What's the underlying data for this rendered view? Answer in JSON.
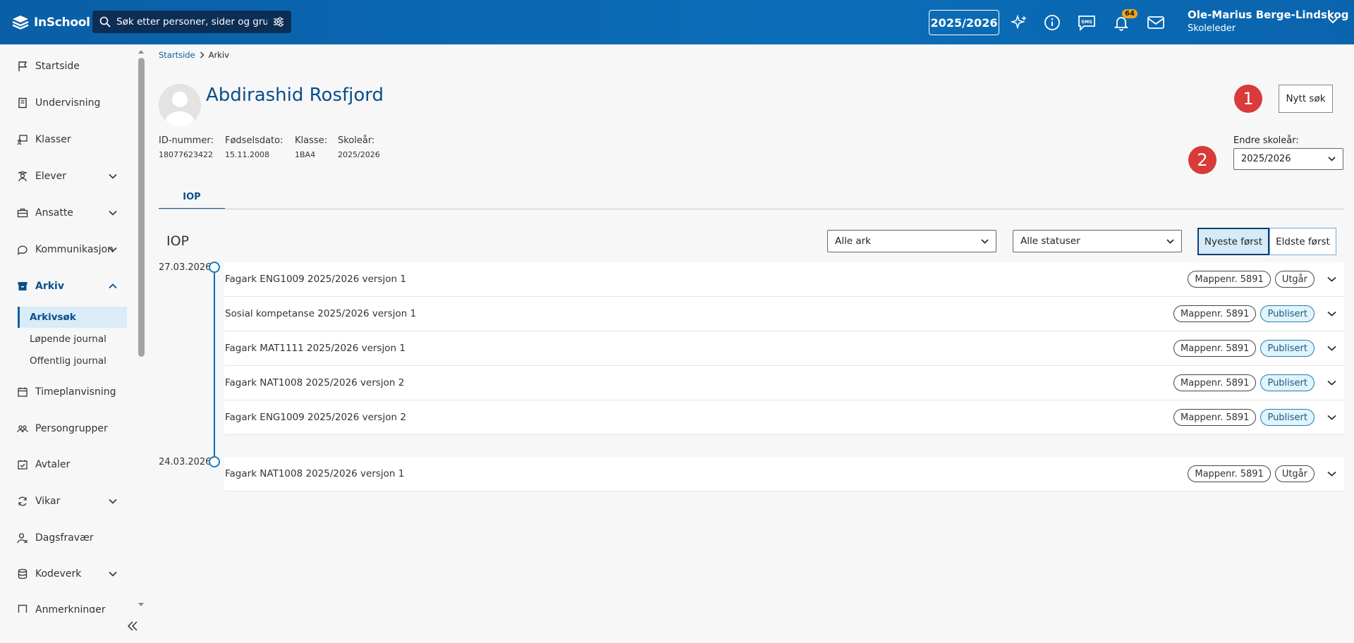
{
  "header": {
    "logo_text": "InSchool",
    "search_placeholder": "Søk etter personer, sider og gru",
    "school_year": "2025/2026",
    "notification_count": "64",
    "user_name": "Ole-Marius Berge-Lindskog",
    "user_role": "Skoleleder"
  },
  "sidebar": {
    "items": [
      {
        "label": "Startside",
        "icon": "flag-icon"
      },
      {
        "label": "Undervisning",
        "icon": "book-icon"
      },
      {
        "label": "Klasser",
        "icon": "classroom-icon"
      },
      {
        "label": "Elever",
        "icon": "students-icon"
      },
      {
        "label": "Ansatte",
        "icon": "briefcase-icon"
      },
      {
        "label": "Kommunikasjon",
        "icon": "chat-icon"
      },
      {
        "label": "Arkiv",
        "icon": "archive-icon"
      },
      {
        "label": "Timeplanvisning",
        "icon": "calendar-icon"
      },
      {
        "label": "Persongrupper",
        "icon": "group-icon"
      },
      {
        "label": "Avtaler",
        "icon": "calendar-check-icon"
      },
      {
        "label": "Vikar",
        "icon": "swap-icon"
      },
      {
        "label": "Dagsfravær",
        "icon": "user-absence-icon"
      },
      {
        "label": "Kodeverk",
        "icon": "database-icon"
      },
      {
        "label": "Anmerkninger",
        "icon": "note-icon"
      }
    ],
    "sub_items": [
      "Arkivsøk",
      "Løpende journal",
      "Offentlig journal"
    ]
  },
  "breadcrumb": {
    "home": "Startside",
    "current": "Arkiv"
  },
  "person": {
    "name": "Abdirashid Rosfjord",
    "fields": [
      {
        "label": "ID-nummer:",
        "value": "18077623422"
      },
      {
        "label": "Fødselsdato:",
        "value": "15.11.2008"
      },
      {
        "label": "Klasse:",
        "value": "1BA4"
      },
      {
        "label": "Skoleår:",
        "value": "2025/2026"
      }
    ]
  },
  "annotations": {
    "one": "1",
    "two": "2"
  },
  "actions": {
    "new_search": "Nytt søk",
    "change_year_label": "Endre skoleår:",
    "change_year_value": "2025/2026"
  },
  "tabs": [
    {
      "label": "IOP"
    }
  ],
  "section": {
    "title": "IOP",
    "filter_sheets": "Alle ark",
    "filter_status": "Alle statuser",
    "sort_newest": "Nyeste først",
    "sort_oldest": "Eldste først"
  },
  "timeline": [
    {
      "date": "27.03.2026",
      "entries": [
        {
          "title": "Fagark ENG1009 2025/2026 versjon 1",
          "folder": "Mappenr. 5891",
          "status": "Utgår"
        },
        {
          "title": "Sosial kompetanse 2025/2026 versjon 1",
          "folder": "Mappenr. 5891",
          "status": "Publisert"
        },
        {
          "title": "Fagark MAT1111 2025/2026 versjon 1",
          "folder": "Mappenr. 5891",
          "status": "Publisert"
        },
        {
          "title": "Fagark NAT1008 2025/2026 versjon 2",
          "folder": "Mappenr. 5891",
          "status": "Publisert"
        },
        {
          "title": "Fagark ENG1009 2025/2026 versjon 2",
          "folder": "Mappenr. 5891",
          "status": "Publisert"
        }
      ]
    },
    {
      "date": "24.03.2026",
      "entries": [
        {
          "title": "Fagark NAT1008 2025/2026 versjon 1",
          "folder": "Mappenr. 5891",
          "status": "Utgår"
        }
      ]
    }
  ],
  "colors": {
    "header_bg": "#0b6db8",
    "accent": "#0b5fa6",
    "badge": "#f2a41b",
    "marker_red": "#d93a3a",
    "published_bg": "#e0f4fb"
  }
}
